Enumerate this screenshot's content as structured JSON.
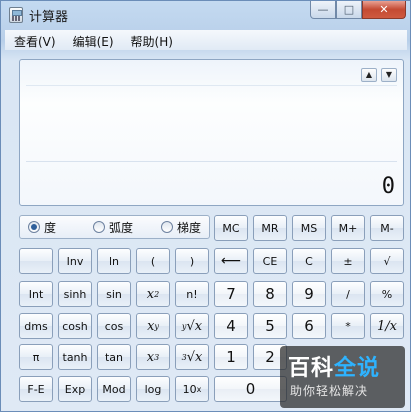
{
  "window": {
    "title": "计算器",
    "controls": {
      "minimize": "—",
      "maximize": "□",
      "close": "✕"
    }
  },
  "menu": [
    "查看(V)",
    "编辑(E)",
    "帮助(H)"
  ],
  "display": {
    "value": "0",
    "scroll_up": "▲",
    "scroll_down": "▼"
  },
  "angle_mode": {
    "options": [
      "度",
      "弧度",
      "梯度"
    ],
    "selected": "度"
  },
  "memory_keys": [
    "MC",
    "MR",
    "MS",
    "M+",
    "M-"
  ],
  "keys": {
    "inv": "Inv",
    "ln": "ln",
    "lparen": "(",
    "rparen": ")",
    "int": "Int",
    "sinh": "sinh",
    "sin": "sin",
    "x2_base": "x",
    "x2_exp": "2",
    "fact": "n!",
    "dms": "dms",
    "cosh": "cosh",
    "cos": "cos",
    "xy_base": "x",
    "xy_exp": "y",
    "yroot_base": "√x",
    "yroot_idx": "y",
    "pi": "π",
    "tanh": "tanh",
    "tan": "tan",
    "x3_base": "x",
    "x3_exp": "3",
    "cbrt_base": "√x",
    "cbrt_idx": "3",
    "fe": "F-E",
    "exp": "Exp",
    "mod": "Mod",
    "log": "log",
    "tenx_base": "10",
    "tenx_exp": "x",
    "backspace": "⟵",
    "ce": "CE",
    "c": "C",
    "plusminus": "±",
    "sqrt": "√",
    "n7": "7",
    "n8": "8",
    "n9": "9",
    "div": "/",
    "percent": "%",
    "n4": "4",
    "n5": "5",
    "n6": "6",
    "mul": "*",
    "recip": "1/x",
    "n1": "1",
    "n2": "2",
    "n0": "0"
  },
  "watermark": {
    "logo_a": "百科",
    "logo_b": "全说",
    "sub": "助你轻松解决"
  }
}
